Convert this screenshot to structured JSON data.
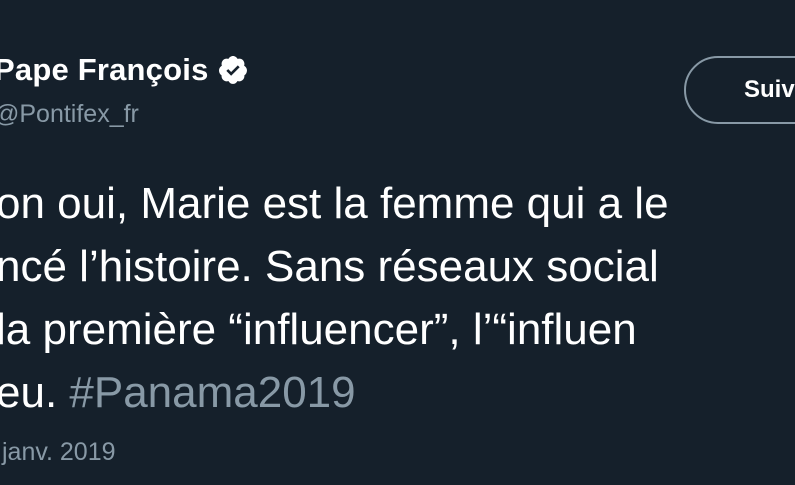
{
  "author": {
    "display_name": "Pape François",
    "handle": "@Pontifex_fr",
    "verified_icon": "verified-badge-icon"
  },
  "actions": {
    "follow_label": "Suiv"
  },
  "tweet": {
    "lines": [
      "on oui, Marie est la femme qui a le",
      "ncé l’histoire. Sans réseaux social",
      "la première “influencer”, l’“influen"
    ],
    "last_line_prefix": "eu. ",
    "hashtag": "#Panama2019"
  },
  "meta": {
    "date": "janv. 2019"
  },
  "colors": {
    "background": "#15202b",
    "primary_text": "#ffffff",
    "secondary_text": "#8899a6",
    "button_border": "#8899a6"
  }
}
